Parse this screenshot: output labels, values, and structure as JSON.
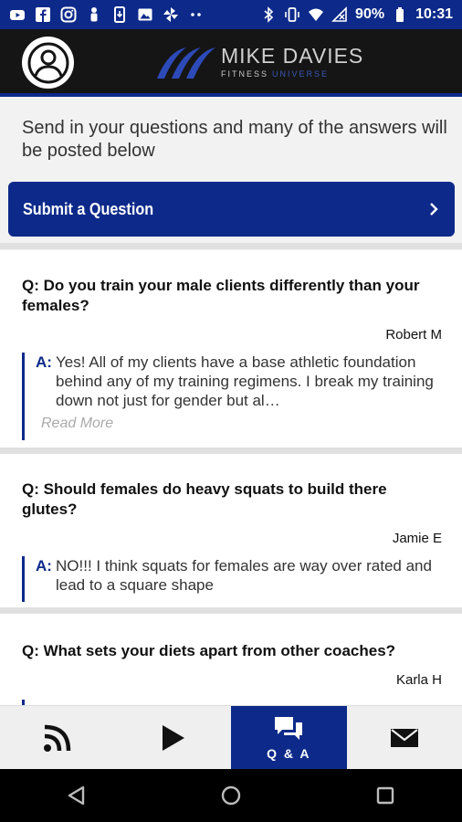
{
  "status": {
    "battery": "90%",
    "time": "10:31",
    "left_icons": [
      "youtube-icon",
      "facebook-icon",
      "instagram-icon",
      "person-icon",
      "phone-icon",
      "image-icon",
      "pinwheel-icon",
      "more-dots-icon"
    ],
    "right_icons": [
      "bluetooth-icon",
      "vibrate-icon",
      "wifi-icon",
      "no-signal-icon",
      "battery-icon"
    ]
  },
  "header": {
    "brand_title": "MIKE DAVIES",
    "brand_sub": "FITNESS",
    "brand_sub2": "UNIVERSE"
  },
  "intro": {
    "text": "Send in your questions and many of the answers will be posted below",
    "submit_label": "Submit a Question"
  },
  "qa": [
    {
      "question": "Q: Do you train your male clients differently than your females?",
      "author": "Robert M",
      "answer_prefix": "A:",
      "answer": "Yes! All of my clients have a base athletic foundation behind any of my training regimens. I break my training down not just for gender but al…",
      "read_more": "Read More"
    },
    {
      "question": "Q: Should females do heavy squats to build there glutes?",
      "author": "Jamie E",
      "answer_prefix": "A:",
      "answer": "NO!!! I think squats for females are way over rated and lead to a square shape"
    },
    {
      "question": "Q: What sets your diets apart from other coaches?",
      "author": "Karla H"
    }
  ],
  "tabs": [
    {
      "icon": "rss-icon",
      "label": ""
    },
    {
      "icon": "play-icon",
      "label": ""
    },
    {
      "icon": "chat-icon",
      "label": "Q & A",
      "active": true
    },
    {
      "icon": "mail-icon",
      "label": ""
    }
  ],
  "nav": [
    "back-icon",
    "home-icon",
    "recents-icon"
  ],
  "colors": {
    "brand_blue": "#0d2a8a",
    "header_black": "#151515"
  }
}
